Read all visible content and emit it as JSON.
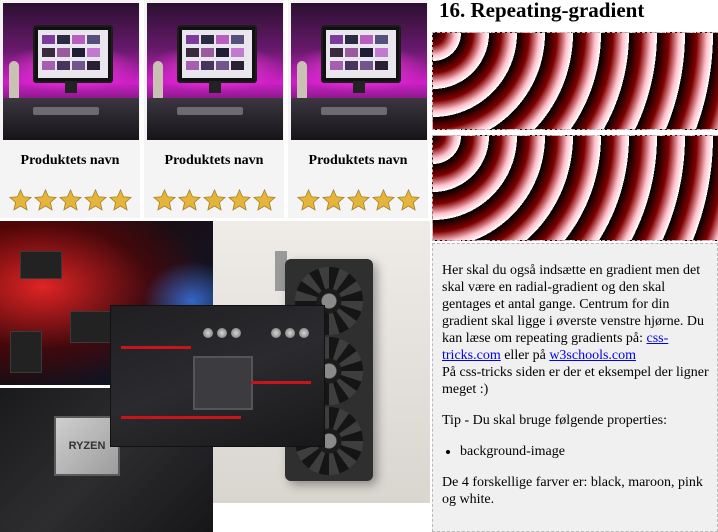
{
  "products": [
    {
      "name": "Produktets navn",
      "rating": 5,
      "max_rating": 5,
      "image": "desktop-setup-image"
    },
    {
      "name": "Produktets navn",
      "rating": 5,
      "max_rating": 5,
      "image": "desktop-setup-image"
    },
    {
      "name": "Produktets navn",
      "rating": 5,
      "max_rating": 5,
      "image": "desktop-setup-image"
    }
  ],
  "colors": {
    "star": "#e5b53b",
    "link": "#0000ee",
    "panel_bg": "#f0f0f0",
    "gradient_colors": [
      "#000000",
      "#800000",
      "#ffc0cb",
      "#ffffff"
    ]
  },
  "section": {
    "title": "16. Repeating-gradient"
  },
  "assignment": {
    "intro_before_link": "Her skal du også indsætte en gradient men det skal være en radial-gradient og den skal gentages et antal gange. Centrum for din gradient skal ligge i øverste venstre hjørne. Du kan læse om repeating gradients på: ",
    "link_1": "css-tricks.com",
    "between_links": " eller på ",
    "link_2": "w3schools.com",
    "after_links": "På css-tricks siden er der et eksempel der ligner meget :)",
    "tip": "Tip - Du skal bruge følgende properties:",
    "properties": [
      "background-image"
    ],
    "colors_note": "De 4 forskellige farver er: black, maroon, pink og white."
  },
  "photos": {
    "cpu_label": "RYZEN"
  }
}
